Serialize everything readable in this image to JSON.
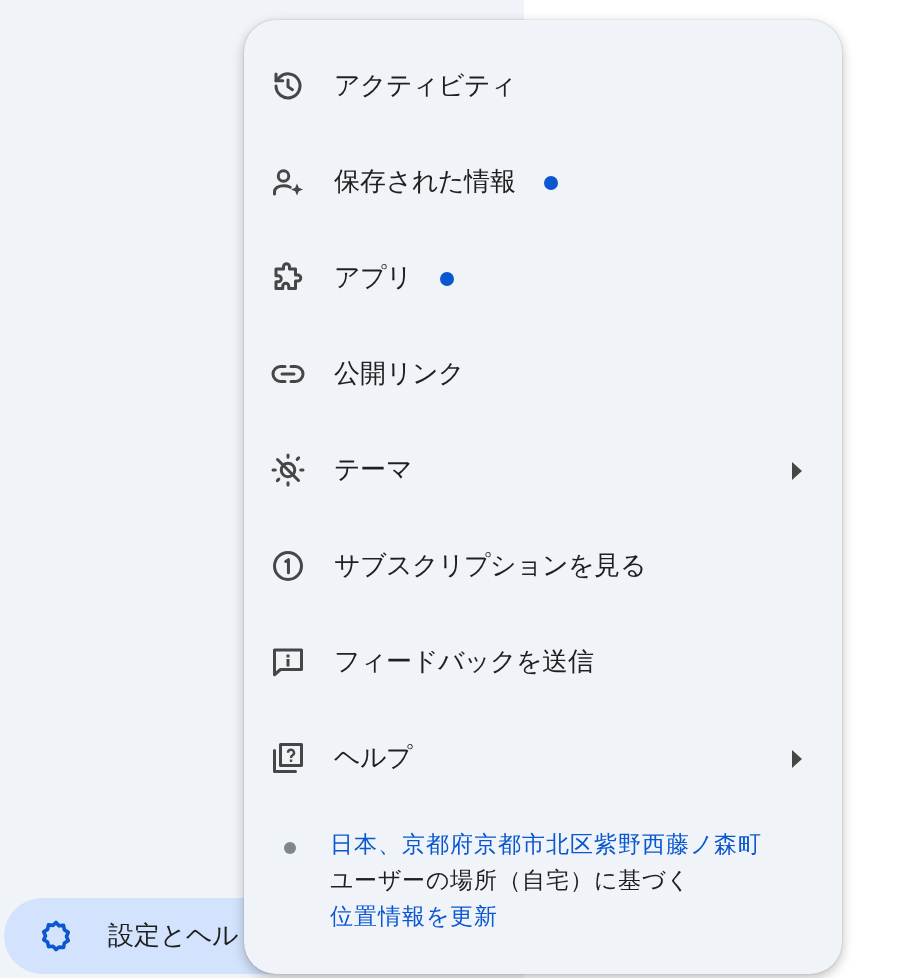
{
  "sidebar": {
    "settings_button": {
      "label": "設定とヘル"
    }
  },
  "menu": {
    "items": [
      {
        "label": "アクティビティ",
        "dot": false,
        "submenu": false
      },
      {
        "label": "保存された情報",
        "dot": true,
        "submenu": false
      },
      {
        "label": "アプリ",
        "dot": true,
        "submenu": false
      },
      {
        "label": "公開リンク",
        "dot": false,
        "submenu": false
      },
      {
        "label": "テーマ",
        "dot": false,
        "submenu": true
      },
      {
        "label": "サブスクリプションを見る",
        "dot": false,
        "submenu": false
      },
      {
        "label": "フィードバックを送信",
        "dot": false,
        "submenu": false
      },
      {
        "label": "ヘルプ",
        "dot": false,
        "submenu": true
      }
    ],
    "location": {
      "place": "日本、京都府京都市北区紫野西藤ノ森町",
      "source": "ユーザーの場所（自宅）に基づく",
      "update_link": "位置情報を更新"
    }
  }
}
